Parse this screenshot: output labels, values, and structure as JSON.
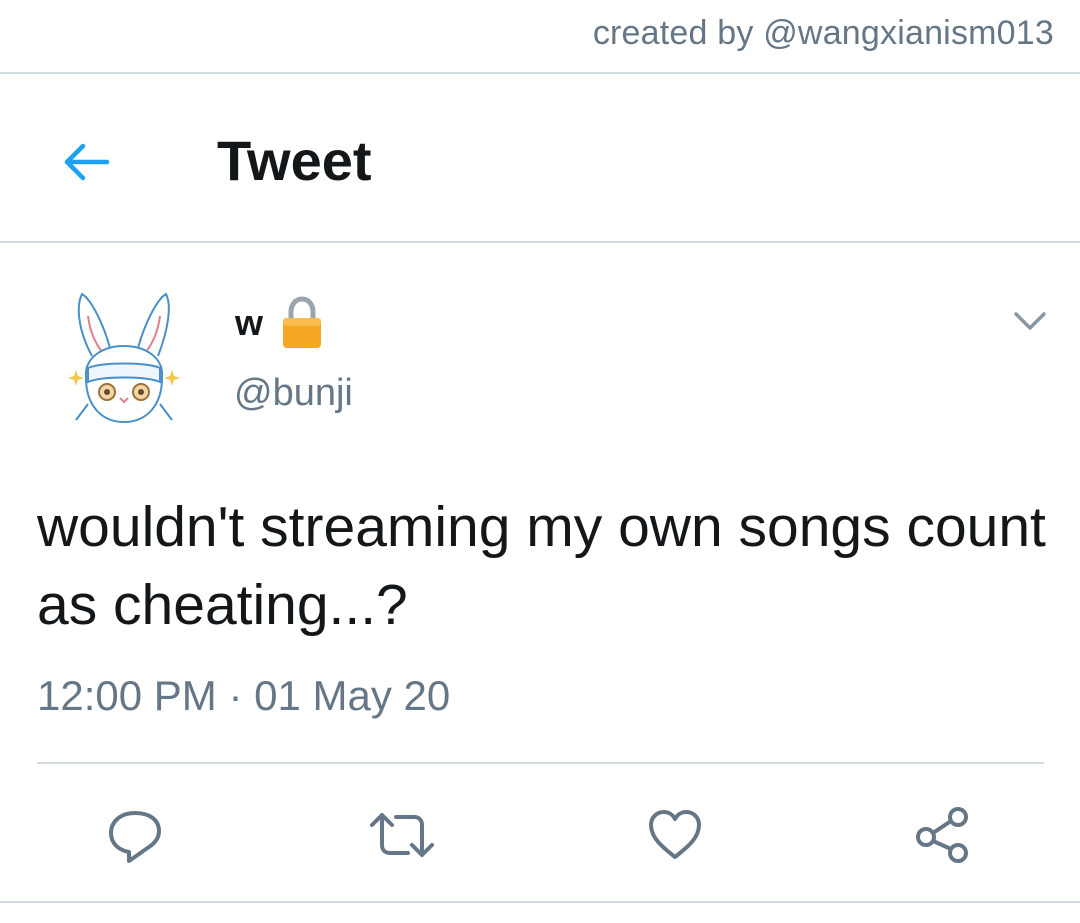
{
  "credit": "created by @wangxianism013",
  "header": {
    "title": "Tweet",
    "back_icon": "arrow-left-icon"
  },
  "tweet": {
    "display_name": "w",
    "handle": "@bunji",
    "protected_icon": "lock-icon",
    "text": "wouldn't streaming my own songs count as cheating...?",
    "timestamp": "12:00 PM · 01 May 20"
  },
  "actions": [
    {
      "name": "reply",
      "icon": "comment-icon"
    },
    {
      "name": "retweet",
      "icon": "retweet-icon"
    },
    {
      "name": "like",
      "icon": "heart-icon"
    },
    {
      "name": "share",
      "icon": "share-icon"
    }
  ],
  "colors": {
    "accent": "#1da1f2",
    "text": "#14171a",
    "secondary": "#657786",
    "divider": "#d3dbe1",
    "lock": "#f5a623"
  }
}
